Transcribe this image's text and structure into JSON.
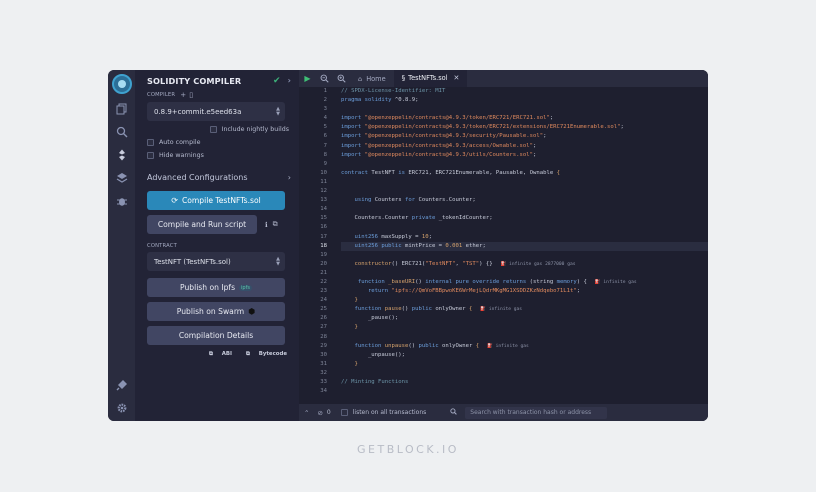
{
  "sidebar": {
    "title": "SOLIDITY COMPILER",
    "compiler_label": "COMPILER",
    "compiler_version": "0.8.9+commit.e5eed63a",
    "include_nightly": "Include nightly builds",
    "auto_compile": "Auto compile",
    "hide_warnings": "Hide warnings",
    "advanced": "Advanced Configurations",
    "compile_button": "Compile TestNFTs.sol",
    "compile_run_button": "Compile and Run script",
    "contract_label": "CONTRACT",
    "contract_value": "TestNFT (TestNFTs.sol)",
    "publish_ipfs": "Publish on Ipfs",
    "publish_swarm": "Publish on Swarm",
    "compilation_details": "Compilation Details",
    "abi": "ABI",
    "bytecode": "Bytecode"
  },
  "tabs": {
    "home": "Home",
    "file": "TestNFTs.sol"
  },
  "code": {
    "line_numbers": [
      "1",
      "2",
      "3",
      "4",
      "5",
      "6",
      "7",
      "8",
      "9",
      "10",
      "11",
      "12",
      "13",
      "14",
      "15",
      "16",
      "17",
      "18",
      "19",
      "20",
      "21",
      "22",
      "23",
      "24",
      "25",
      "26",
      "27",
      "28",
      "29",
      "30",
      "31",
      "32",
      "33",
      "34"
    ],
    "l1": "// SPDX-License-Identifier: MIT",
    "l2a": "pragma",
    "l2b": " solidity ",
    "l2c": "^0.8.9;",
    "i_kw": "import ",
    "l4": "\"@openzeppelin/contracts@4.9.3/token/ERC721/ERC721.sol\"",
    "l5": "\"@openzeppelin/contracts@4.9.3/token/ERC721/extensions/ERC721Enumerable.sol\"",
    "l6": "\"@openzeppelin/contracts@4.9.3/security/Pausable.sol\"",
    "l7": "\"@openzeppelin/contracts@4.9.3/access/Ownable.sol\"",
    "l8": "\"@openzeppelin/contracts@4.9.3/utils/Counters.sol\"",
    "semi": ";",
    "l10a": "contract ",
    "l10b": "TestNFT ",
    "l10c": "is ",
    "l10d": "ERC721, ERC721Enumerable, Pausable, Ownable ",
    "l10e": "{",
    "l13a": "    using ",
    "l13b": "Counters ",
    "l13c": "for ",
    "l13d": "Counters.Counter;",
    "l15a": "    Counters.Counter ",
    "l15b": "private ",
    "l15c": "_tokenIdCounter;",
    "l17a": "    uint256 ",
    "l17b": "maxSupply = ",
    "l17c": "10",
    "l17d": ";",
    "l18a": "    uint256 ",
    "l18b": "public ",
    "l18c": "mintPrice = ",
    "l18d": "0.001",
    "l18e": " ether;",
    "l20a": "    constructor",
    "l20b": "() ERC721(",
    "l20c": "\"TestNFT\"",
    "l20d": ", ",
    "l20e": "\"TST\"",
    "l20f": ") {}",
    "l20gas": "infinite gas 2877000 gas",
    "l22a": "     function ",
    "l22b": "_baseURI",
    "l22c": "() ",
    "l22d": "internal pure override returns ",
    "l22e": "(string ",
    "l22f": "memory",
    "l22g": ") {",
    "l22gas": "infinite gas",
    "l23a": "        return ",
    "l23b": "\"ipfs://QmVoFBBpwoKE6WrMejLQdrMKgMG1XSDDZKzNdqebo71L1t\"",
    "l23c": ";",
    "l24": "    }",
    "l25a": "    function ",
    "l25b": "pause",
    "l25c": "() ",
    "l25d": "public ",
    "l25e": "onlyOwner ",
    "l25f": "{",
    "l25gas": "infinite gas",
    "l26": "        _pause();",
    "l27": "    }",
    "l29a": "    function ",
    "l29b": "unpause",
    "l29c": "() ",
    "l29d": "public ",
    "l29e": "onlyOwner ",
    "l29f": "{",
    "l29gas": "infinite gas",
    "l30": "        _unpause();",
    "l31": "    }",
    "l33": "// Minting Functions"
  },
  "bottom": {
    "count": "0",
    "listen": "listen on all transactions",
    "search_placeholder": "Search with transaction hash or address"
  },
  "footer": "GETBLOCK.IO",
  "colors": {
    "primary_button": "#2a88b9",
    "check_green": "#3db17a",
    "background": "#222336"
  }
}
